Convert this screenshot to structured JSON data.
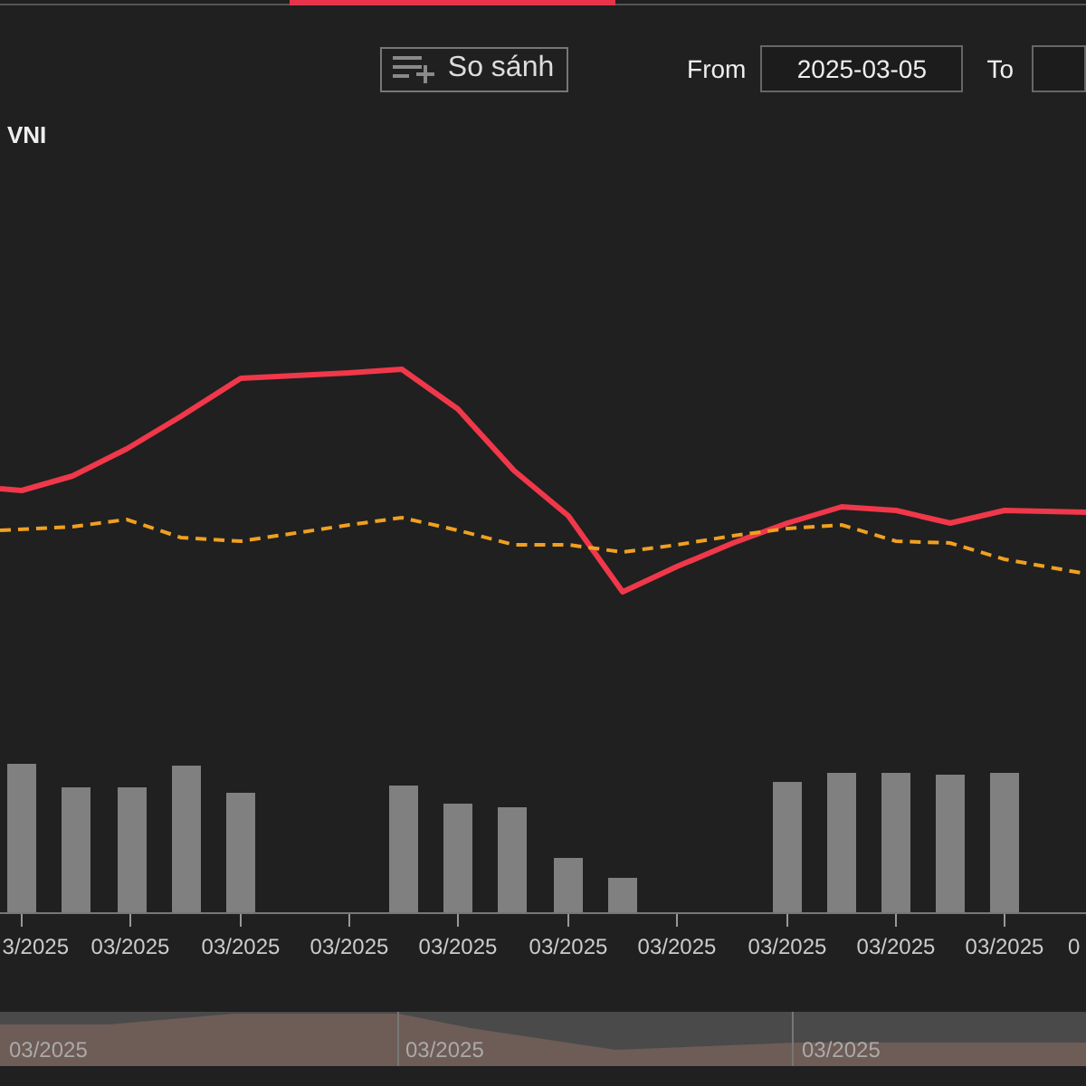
{
  "compare_button": {
    "label": "So sánh"
  },
  "date_range": {
    "from_label": "From",
    "from_value": "2025-03-05",
    "to_label": "To"
  },
  "chart": {
    "title": "VNI",
    "x_labels": [
      "3/2025",
      "03/2025",
      "03/2025",
      "03/2025",
      "03/2025",
      "03/2025",
      "03/2025",
      "03/2025",
      "03/2025",
      "03/2025",
      "0"
    ],
    "navigator_labels": [
      "03/2025",
      "03/2025",
      "03/2025"
    ]
  }
}
